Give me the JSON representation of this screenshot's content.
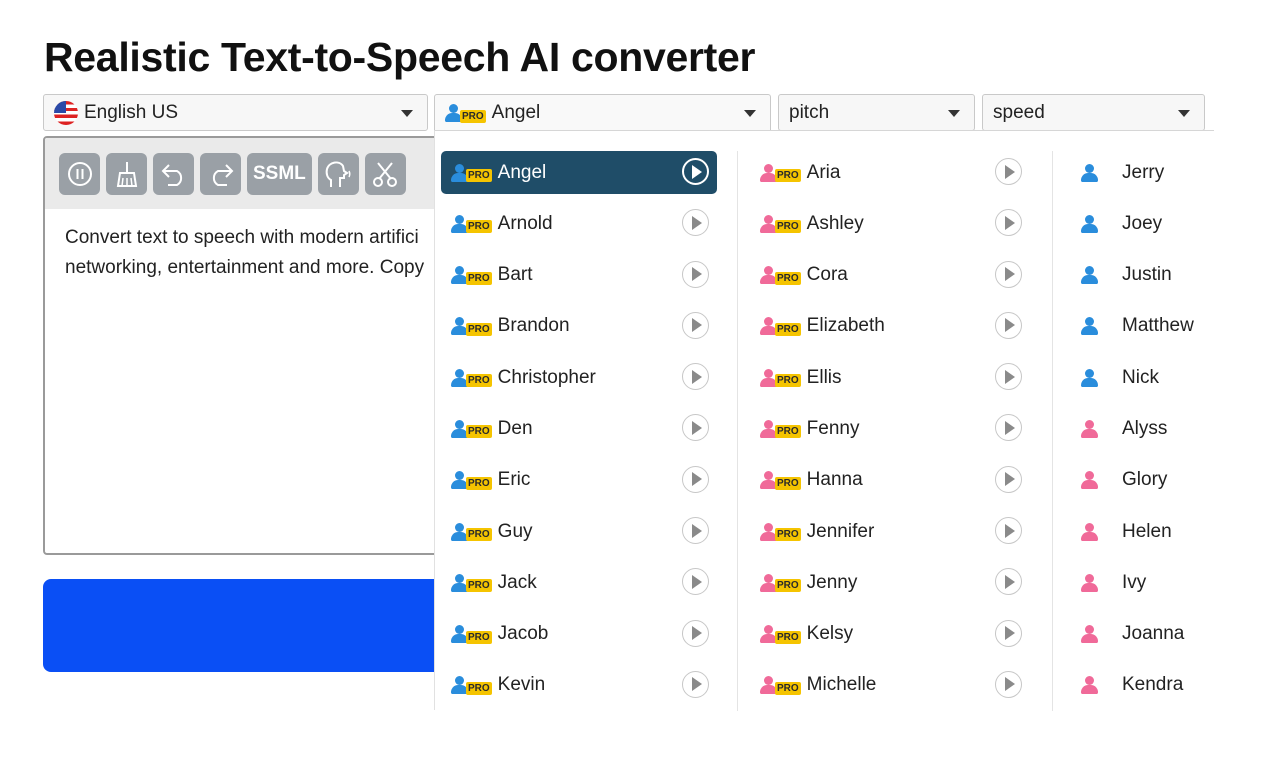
{
  "title": "Realistic Text-to-Speech AI converter",
  "selects": {
    "language": "English US",
    "voice": "Angel",
    "pitch": "pitch",
    "speed": "speed",
    "pro_badge": "PRO"
  },
  "toolbar": {
    "ssml_label": "SSML"
  },
  "editor": {
    "line1": "Convert text to speech with modern artifici",
    "line2": "networking, entertainment and more. Copy"
  },
  "voices": {
    "male_pro": [
      "Angel",
      "Arnold",
      "Bart",
      "Brandon",
      "Christopher",
      "Den",
      "Eric",
      "Guy",
      "Jack",
      "Jacob",
      "Kevin"
    ],
    "female_pro": [
      "Aria",
      "Ashley",
      "Cora",
      "Elizabeth",
      "Ellis",
      "Fenny",
      "Hanna",
      "Jennifer",
      "Jenny",
      "Kelsy",
      "Michelle"
    ],
    "standard": [
      {
        "name": "Jerry",
        "gender": "m"
      },
      {
        "name": "Joey",
        "gender": "m"
      },
      {
        "name": "Justin",
        "gender": "m"
      },
      {
        "name": "Matthew",
        "gender": "m"
      },
      {
        "name": "Nick",
        "gender": "m"
      },
      {
        "name": "Alyss",
        "gender": "f"
      },
      {
        "name": "Glory",
        "gender": "f"
      },
      {
        "name": "Helen",
        "gender": "f"
      },
      {
        "name": "Ivy",
        "gender": "f"
      },
      {
        "name": "Joanna",
        "gender": "f"
      },
      {
        "name": "Kendra",
        "gender": "f"
      }
    ]
  },
  "colors": {
    "accent": "#0a4ff5",
    "selected": "#1f4d68",
    "male": "#2a8ddc",
    "female": "#f06a99",
    "pro": "#f5c400"
  }
}
